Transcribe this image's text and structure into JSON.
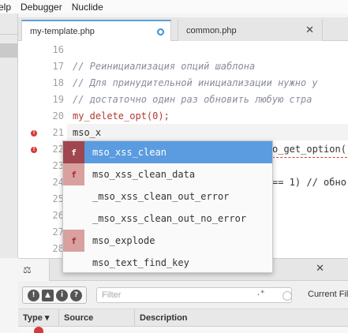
{
  "menubar": {
    "items": [
      "elp",
      "Debugger",
      "Nuclide"
    ]
  },
  "tabs": [
    {
      "label": "my-template.php",
      "modified": true
    },
    {
      "label": "common.php",
      "close_icon": "close-icon"
    }
  ],
  "editor": {
    "lines": [
      {
        "number": "16",
        "text": ""
      },
      {
        "number": "17",
        "text": "// Реинициализация опций шаблона"
      },
      {
        "number": "18",
        "text": "// Для принудительной инициализации нужно у"
      },
      {
        "number": "19",
        "text": "// достаточно один раз обновить любую стра"
      },
      {
        "number": "20",
        "text": "my_delete_opt(0);"
      },
      {
        "number": "21",
        "text": "mso_x"
      },
      {
        "number": "22",
        "text": "o_get_option("
      },
      {
        "number": "23",
        "text": ""
      },
      {
        "number": "24",
        "text": "== 1) // обно"
      },
      {
        "number": "25",
        "text": ""
      },
      {
        "number": "26",
        "text": ""
      },
      {
        "number": "27",
        "text": ""
      },
      {
        "number": "28",
        "text": ""
      }
    ]
  },
  "autocomplete": {
    "items": [
      {
        "type": "f",
        "label": "mso_xss_clean",
        "selected": true
      },
      {
        "type": "f",
        "label": "mso_xss_clean_data",
        "selected": false
      },
      {
        "type": "",
        "label": "_mso_xss_clean_out_error",
        "selected": false
      },
      {
        "type": "",
        "label": "_mso_xss_clean_out_no_error",
        "selected": false
      },
      {
        "type": "f",
        "label": "mso_explode",
        "selected": false
      },
      {
        "type": "",
        "label": "mso_text_find_key",
        "selected": false
      }
    ]
  },
  "diagnostics": {
    "tab_icon": "scale-icon",
    "severity_buttons": [
      "!",
      "▲",
      "i",
      "?"
    ],
    "filter_placeholder": "Filter",
    "regex_label": ".*",
    "current_file_label": "Current File",
    "columns": [
      "Type ▾",
      "Source",
      "Description"
    ]
  },
  "colors": {
    "accent": "#5fa0de",
    "error": "#d53a3a",
    "selection": "#5b9be0",
    "function_badge": "#d9a0a0"
  }
}
